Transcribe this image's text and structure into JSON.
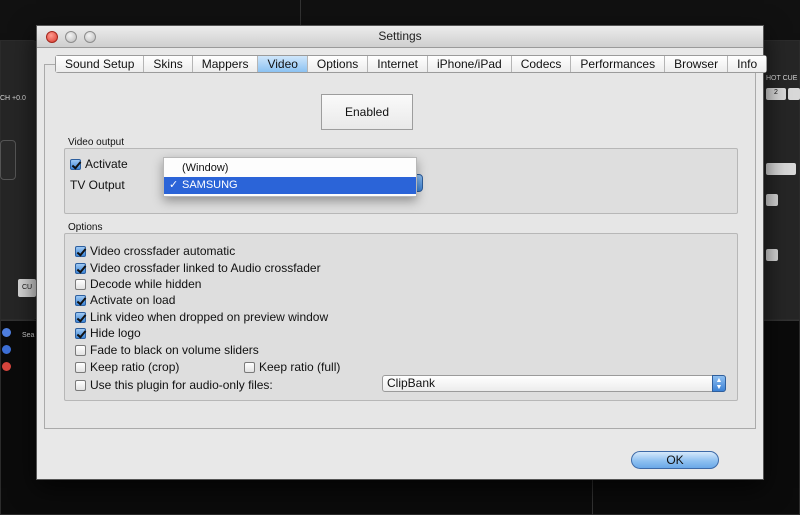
{
  "background": {
    "left_text": "CH +0.0",
    "left_button": "CU",
    "hot_cue_label": "HOT CUE",
    "hot_cue_number": "2",
    "search_label": "Sea"
  },
  "dialog": {
    "title": "Settings",
    "tabs": [
      {
        "label": "Sound Setup",
        "active": false
      },
      {
        "label": "Skins",
        "active": false
      },
      {
        "label": "Mappers",
        "active": false
      },
      {
        "label": "Video",
        "active": true
      },
      {
        "label": "Options",
        "active": false
      },
      {
        "label": "Internet",
        "active": false
      },
      {
        "label": "iPhone/iPad",
        "active": false
      },
      {
        "label": "Codecs",
        "active": false
      },
      {
        "label": "Performances",
        "active": false
      },
      {
        "label": "Browser",
        "active": false
      },
      {
        "label": "Info",
        "active": false
      }
    ],
    "enabled_button": "Enabled",
    "video_output": {
      "group_label": "Video output",
      "activate_label": "Activate",
      "activate_checked": true,
      "tv_output_label": "TV Output",
      "tv_output_options": [
        "(Window)",
        "SAMSUNG"
      ],
      "tv_output_selected": "SAMSUNG",
      "tick": "✓"
    },
    "options": {
      "group_label": "Options",
      "items": [
        {
          "label": "Video crossfader automatic",
          "checked": true
        },
        {
          "label": "Video crossfader linked to Audio crossfader",
          "checked": true
        },
        {
          "label": "Decode while hidden",
          "checked": false
        },
        {
          "label": "Activate on load",
          "checked": true
        },
        {
          "label": "Link video when dropped on preview window",
          "checked": true
        },
        {
          "label": "Hide logo",
          "checked": true
        },
        {
          "label": "Fade to black on volume sliders",
          "checked": false
        }
      ],
      "keep_ratio_crop": {
        "label": "Keep ratio (crop)",
        "checked": false
      },
      "keep_ratio_full": {
        "label": "Keep ratio (full)",
        "checked": false
      },
      "audio_only": {
        "label": "Use this plugin for audio-only files:",
        "checked": false
      },
      "plugin_select_value": "ClipBank"
    },
    "ok_button": "OK"
  },
  "colors": {
    "accent": "#3c82d6",
    "selection": "#2b64d8",
    "close_button": "#d8392d"
  }
}
